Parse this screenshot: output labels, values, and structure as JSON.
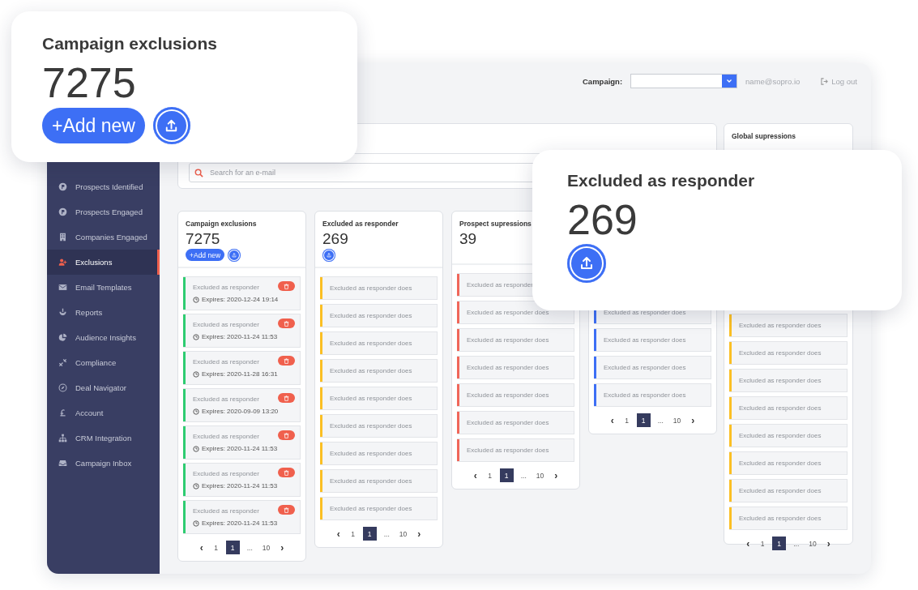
{
  "header": {
    "campaign_label": "Campaign:",
    "user_email": "name@sopro.io",
    "logout": "Log out"
  },
  "sidebar": {
    "items": [
      {
        "label": "Prospects Identified",
        "selected": false
      },
      {
        "label": "Prospects Engaged",
        "selected": false
      },
      {
        "label": "Companies Engaged",
        "selected": false
      },
      {
        "label": "Exclusions",
        "selected": true
      },
      {
        "label": "Email Templates",
        "selected": false
      },
      {
        "label": "Reports",
        "selected": false
      },
      {
        "label": "Audience Insights",
        "selected": false
      },
      {
        "label": "Compliance",
        "selected": false
      },
      {
        "label": "Deal Navigator",
        "selected": false
      },
      {
        "label": "Account",
        "selected": false
      },
      {
        "label": "CRM Integration",
        "selected": false
      },
      {
        "label": "Campaign Inbox",
        "selected": false
      }
    ]
  },
  "search": {
    "placeholder": "Search for an e-mail"
  },
  "columns": [
    {
      "kind": "expiring",
      "title": "Campaign exclusions",
      "count": "7275",
      "add_button": "+Add new",
      "upload": true,
      "color": "#2ecc71",
      "items": [
        {
          "title": "Excluded as responder",
          "expires": "Expires: 2020-12-24 19:14"
        },
        {
          "title": "Excluded as responder",
          "expires": "Expires: 2020-11-24 11:53"
        },
        {
          "title": "Excluded as responder",
          "expires": "Expires: 2020-11-28 16:31"
        },
        {
          "title": "Excluded as responder",
          "expires": "Expires: 2020-09-09 13:20"
        },
        {
          "title": "Excluded as responder",
          "expires": "Expires: 2020-11-24 11:53"
        },
        {
          "title": "Excluded as responder",
          "expires": "Expires: 2020-11-24 11:53"
        },
        {
          "title": "Excluded as responder",
          "expires": "Expires: 2020-11-24 11:53"
        }
      ],
      "pager": {
        "prev": "‹",
        "pages": [
          {
            "label": "1",
            "selected": false
          },
          {
            "label": "1",
            "selected": true
          },
          {
            "label": "...",
            "selected": false
          },
          {
            "label": "10",
            "selected": false
          }
        ],
        "next": "›"
      }
    },
    {
      "kind": "plain",
      "title": "Excluded as responder",
      "count": "269",
      "upload": true,
      "color": "#fbbf24",
      "items": [
        {
          "title": "Excluded as responder does"
        },
        {
          "title": "Excluded as responder does"
        },
        {
          "title": "Excluded as responder does"
        },
        {
          "title": "Excluded as responder does"
        },
        {
          "title": "Excluded as responder does"
        },
        {
          "title": "Excluded as responder does"
        },
        {
          "title": "Excluded as responder does"
        },
        {
          "title": "Excluded as responder does"
        },
        {
          "title": "Excluded as responder does"
        }
      ],
      "pager": {
        "prev": "‹",
        "pages": [
          {
            "label": "1",
            "selected": false
          },
          {
            "label": "1",
            "selected": true
          },
          {
            "label": "...",
            "selected": false
          },
          {
            "label": "10",
            "selected": false
          }
        ],
        "next": "›"
      }
    },
    {
      "kind": "plain",
      "title": "Prospect supressions",
      "count": "39",
      "color": "#f0675a",
      "items": [
        {
          "title": "Excluded as responder"
        },
        {
          "title": "Excluded as responder does"
        },
        {
          "title": "Excluded as responder does"
        },
        {
          "title": "Excluded as responder does"
        },
        {
          "title": "Excluded as responder does"
        },
        {
          "title": "Excluded as responder does"
        },
        {
          "title": "Excluded as responder does"
        }
      ],
      "pager": {
        "prev": "‹",
        "pages": [
          {
            "label": "1",
            "selected": false
          },
          {
            "label": "1",
            "selected": true
          },
          {
            "label": "...",
            "selected": false
          },
          {
            "label": "10",
            "selected": false
          }
        ],
        "next": "›"
      }
    },
    {
      "kind": "covered",
      "color": "#3d6ff5",
      "items": [
        {
          "title": "Excluded as responder does"
        },
        {
          "title": "Excluded as responder does"
        },
        {
          "title": "Excluded as responder does"
        },
        {
          "title": "Excluded as responder does"
        }
      ],
      "pager": {
        "prev": "‹",
        "pages": [
          {
            "label": "1",
            "selected": false
          },
          {
            "label": "1",
            "selected": true
          },
          {
            "label": "...",
            "selected": false
          },
          {
            "label": "10",
            "selected": false
          }
        ],
        "next": "›"
      }
    }
  ],
  "global": {
    "title": "Global supressions",
    "color": "#fbbf24",
    "items": [
      {
        "title": "Excluded as responder does"
      },
      {
        "title": "Excluded as responder does"
      },
      {
        "title": "Excluded as responder does"
      },
      {
        "title": "Excluded as responder does"
      },
      {
        "title": "Excluded as responder does"
      },
      {
        "title": "Excluded as responder does"
      },
      {
        "title": "Excluded as responder does"
      },
      {
        "title": "Excluded as responder does"
      }
    ],
    "pager": {
      "prev": "‹",
      "pages": [
        {
          "label": "1",
          "selected": false
        },
        {
          "label": "1",
          "selected": true
        },
        {
          "label": "...",
          "selected": false
        },
        {
          "label": "10",
          "selected": false
        }
      ],
      "next": "›"
    }
  },
  "highlights": [
    {
      "title": "Campaign exclusions",
      "count": "7275",
      "add_button": "+Add new",
      "upload": true
    },
    {
      "title": "Excluded as responder",
      "count": "269",
      "upload": true
    }
  ]
}
